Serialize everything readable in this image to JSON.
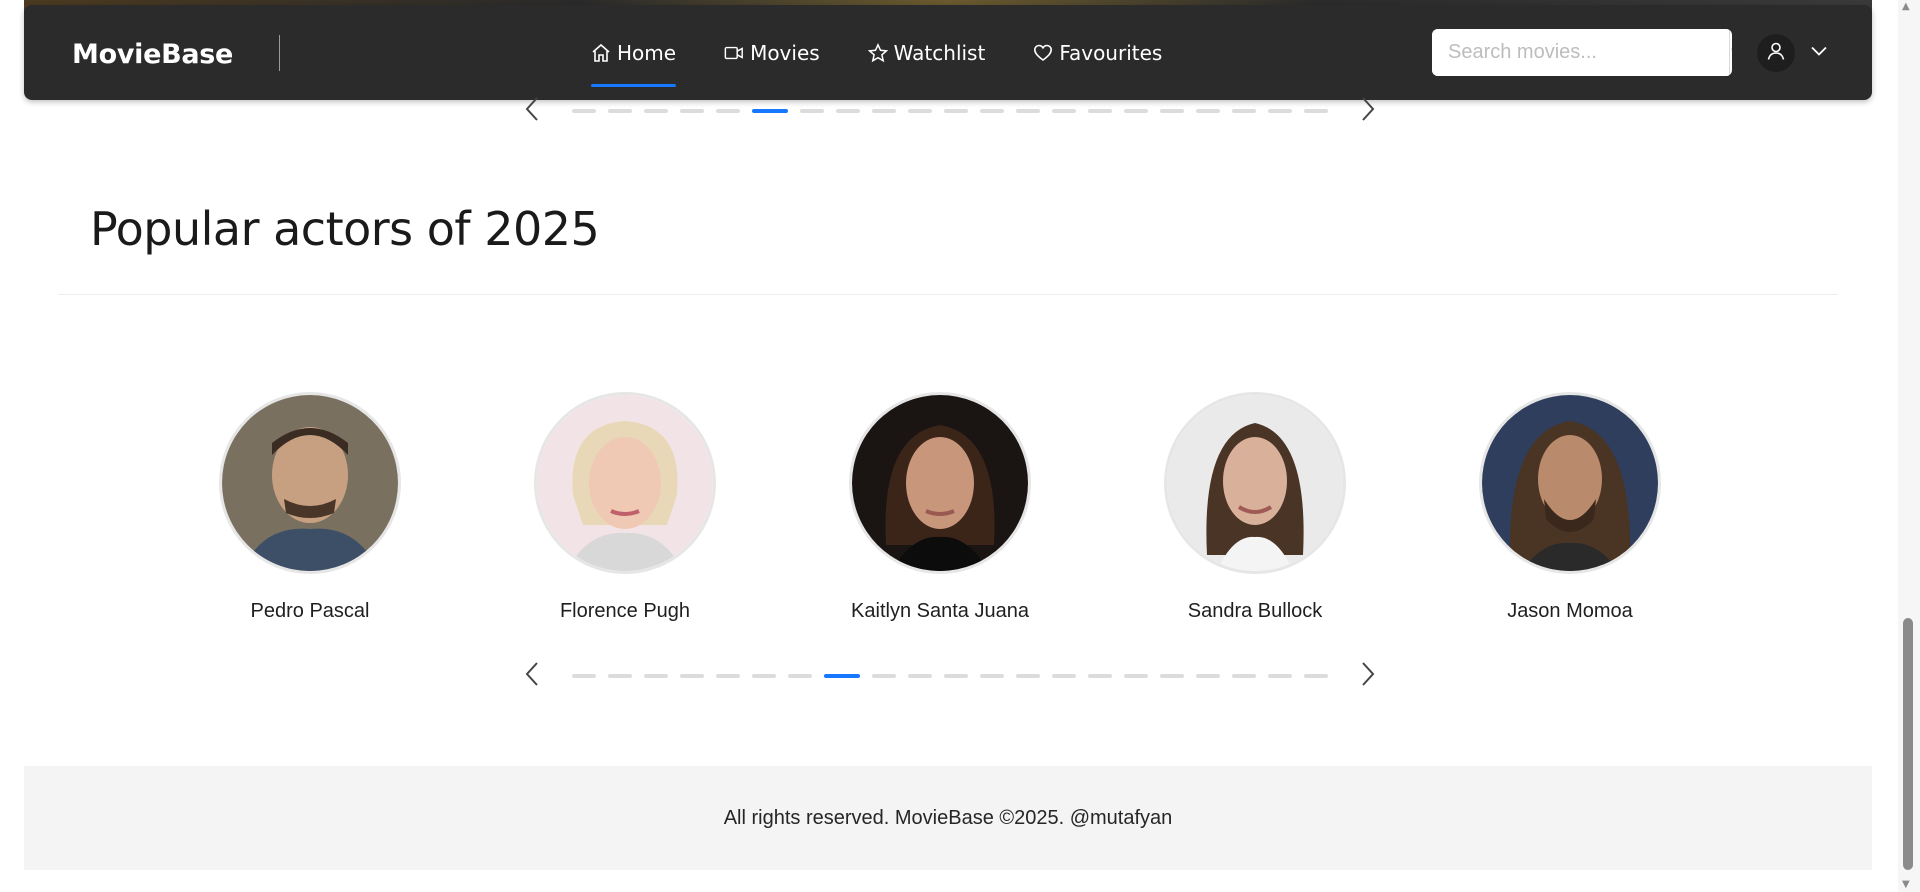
{
  "navbar": {
    "brand": "MovieBase",
    "items": [
      {
        "label": "Home",
        "icon": "home-icon",
        "active": true
      },
      {
        "label": "Movies",
        "icon": "video-icon",
        "active": false
      },
      {
        "label": "Watchlist",
        "icon": "star-icon",
        "active": false
      },
      {
        "label": "Favourites",
        "icon": "heart-icon",
        "active": false
      }
    ],
    "search_placeholder": "Search movies...",
    "accent_color": "#1677ff"
  },
  "top_carousel": {
    "total_dots": 21,
    "active_index": 5
  },
  "actors_section": {
    "title": "Popular actors of 2025",
    "actors": [
      {
        "name": "Pedro Pascal"
      },
      {
        "name": "Florence Pugh"
      },
      {
        "name": "Kaitlyn Santa Juana"
      },
      {
        "name": "Sandra Bullock"
      },
      {
        "name": "Jason Momoa"
      }
    ],
    "carousel": {
      "total_dots": 21,
      "active_index": 7
    }
  },
  "footer": {
    "text": "All rights reserved. MovieBase ©2025. @mutafyan"
  }
}
